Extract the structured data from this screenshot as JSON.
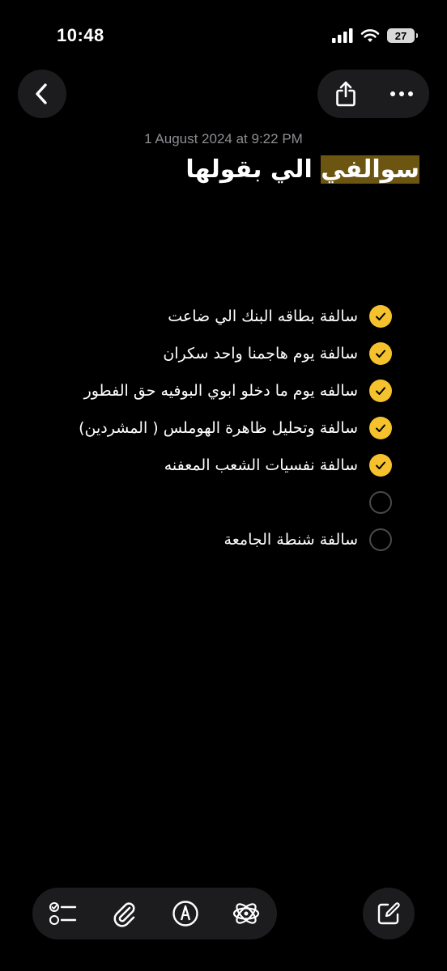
{
  "status_bar": {
    "time": "10:48",
    "battery": "27"
  },
  "note": {
    "date": "1 August 2024 at 9:22 PM",
    "title_highlighted": "سوالفي",
    "title_rest": " الي بقولها"
  },
  "checklist": [
    {
      "label": "سالفة بطاقه البنك الي ضاعت",
      "checked": true
    },
    {
      "label": "سالفة يوم هاجمنا واحد سكران",
      "checked": true
    },
    {
      "label": "سالفه يوم ما دخلو ابوي البوفيه حق الفطور",
      "checked": true
    },
    {
      "label": "سالفة وتحليل ظاهرة الهوملس ( المشردين)",
      "checked": true
    },
    {
      "label": "سالفة نفسيات الشعب المعفنه",
      "checked": true
    },
    {
      "label": "",
      "checked": false
    },
    {
      "label": "سالفة شنطة الجامعة",
      "checked": false
    }
  ],
  "colors": {
    "accent": "#f5c12c",
    "background": "#000000",
    "control": "#1c1c1e",
    "highlight": "#6b5510"
  },
  "icons": {
    "back": "chevron-left-icon",
    "share": "share-icon",
    "more": "ellipsis-icon",
    "checklist": "checklist-icon",
    "attach": "paperclip-icon",
    "markup": "pen-circle-icon",
    "ai": "apple-intelligence-icon",
    "compose": "compose-icon"
  }
}
